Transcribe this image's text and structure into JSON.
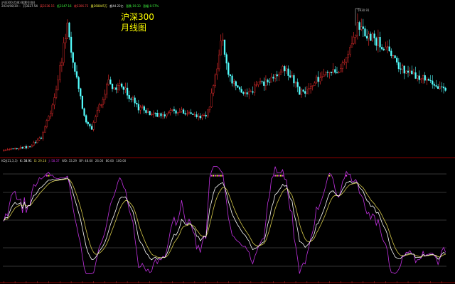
{
  "header": {
    "line1": "沪深300(月线) 股票号(前)",
    "line2": "2024/08/30一",
    "line2_values": [
      "开3327.54",
      "高3336.15",
      "低3147.16",
      "收3306.72",
      "量260845万",
      "额44.22亿",
      "涨跌-19.33",
      "涨幅-0.57%"
    ]
  },
  "title": {
    "line1": "沪深300",
    "line2": "月线图"
  },
  "peak_label": "5930.91",
  "indicator_header": {
    "name": "KDJ(21,3,3)",
    "values": [
      "K: 38.91",
      "D: 29.18",
      "J: 58.37",
      "WD: 33.29",
      "BP: 48.60",
      "26.00",
      "80.00",
      "100.00"
    ]
  },
  "colors": {
    "up": "#ff3030",
    "down": "#54ffff",
    "k_line": "#ffffff",
    "d_line": "#d4c84a",
    "j_line": "#c030e0",
    "title": "#ffff00",
    "divider": "#8b0000"
  },
  "chart_data": [
    {
      "type": "candlestick",
      "name": "沪深300 月线",
      "price_range": [
        900,
        6200
      ],
      "ohlc": []
    },
    {
      "type": "line",
      "name": "KDJ(21,3,3)",
      "ylim": [
        -10,
        110
      ],
      "reference_lines": [
        0,
        20,
        50,
        80,
        100
      ],
      "series": [
        {
          "name": "K",
          "values": []
        },
        {
          "name": "D",
          "values": []
        },
        {
          "name": "J",
          "values": []
        }
      ]
    }
  ]
}
